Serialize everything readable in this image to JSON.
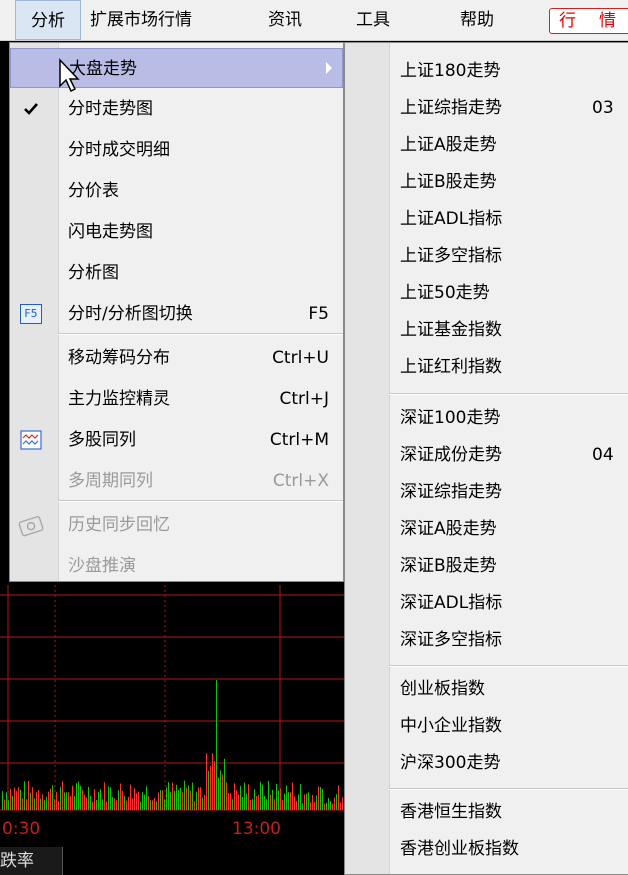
{
  "menubar": {
    "items": [
      "分析",
      "扩展市场行情",
      "资讯",
      "工具",
      "帮助"
    ],
    "quote_button": [
      "行",
      "情"
    ]
  },
  "chart": {
    "times": [
      "0:30",
      "13:00"
    ],
    "bottom_label": "跌率"
  },
  "menu": {
    "items": [
      {
        "label": "大盘走势",
        "shortcut": "",
        "icon": "",
        "enabled": true,
        "submenu": true
      },
      {
        "label": "分时走势图",
        "shortcut": "",
        "icon": "checkmark-icon",
        "enabled": true
      },
      {
        "label": "分时成交明细",
        "shortcut": "",
        "icon": "",
        "enabled": true
      },
      {
        "label": "分价表",
        "shortcut": "",
        "icon": "",
        "enabled": true
      },
      {
        "label": "闪电走势图",
        "shortcut": "",
        "icon": "",
        "enabled": true
      },
      {
        "label": "分析图",
        "shortcut": "",
        "icon": "",
        "enabled": true
      },
      {
        "label": "分时/分析图切换",
        "shortcut": "F5",
        "icon": "f5-icon",
        "enabled": true
      },
      {
        "label": "移动筹码分布",
        "shortcut": "Ctrl+U",
        "icon": "",
        "enabled": true
      },
      {
        "label": "主力监控精灵",
        "shortcut": "Ctrl+J",
        "icon": "",
        "enabled": true
      },
      {
        "label": "多股同列",
        "shortcut": "Ctrl+M",
        "icon": "multi-chart-icon",
        "enabled": true
      },
      {
        "label": "多周期同列",
        "shortcut": "Ctrl+X",
        "icon": "",
        "enabled": false
      },
      {
        "label": "历史同步回忆",
        "shortcut": "",
        "icon": "history-icon",
        "enabled": false
      },
      {
        "label": "沙盘推演",
        "shortcut": "",
        "icon": "",
        "enabled": false
      }
    ],
    "f5_icon_text": "F5"
  },
  "submenu": {
    "items": [
      {
        "label": "上证180走势",
        "code": ""
      },
      {
        "label": "上证综指走势",
        "code": "03"
      },
      {
        "label": "上证A股走势",
        "code": ""
      },
      {
        "label": "上证B股走势",
        "code": ""
      },
      {
        "label": "上证ADL指标",
        "code": ""
      },
      {
        "label": "上证多空指标",
        "code": ""
      },
      {
        "label": "上证50走势",
        "code": ""
      },
      {
        "label": "上证基金指数",
        "code": ""
      },
      {
        "label": "上证红利指数",
        "code": ""
      },
      {
        "label": "深证100走势",
        "code": ""
      },
      {
        "label": "深证成份走势",
        "code": "04"
      },
      {
        "label": "深证综指走势",
        "code": ""
      },
      {
        "label": "深证A股走势",
        "code": ""
      },
      {
        "label": "深证B股走势",
        "code": ""
      },
      {
        "label": "深证ADL指标",
        "code": ""
      },
      {
        "label": "深证多空指标",
        "code": ""
      },
      {
        "label": "创业板指数",
        "code": ""
      },
      {
        "label": "中小企业指数",
        "code": ""
      },
      {
        "label": "沪深300走势",
        "code": ""
      },
      {
        "label": "香港恒生指数",
        "code": ""
      },
      {
        "label": "香港创业板指数",
        "code": ""
      }
    ]
  },
  "colors": {
    "highlight": "#b9bde6",
    "menu_bg": "#f0f0f0",
    "chart_grid": "#b01818",
    "bar_green": "#16c016",
    "bar_red": "#ff3030",
    "quote_red": "#e00000"
  }
}
